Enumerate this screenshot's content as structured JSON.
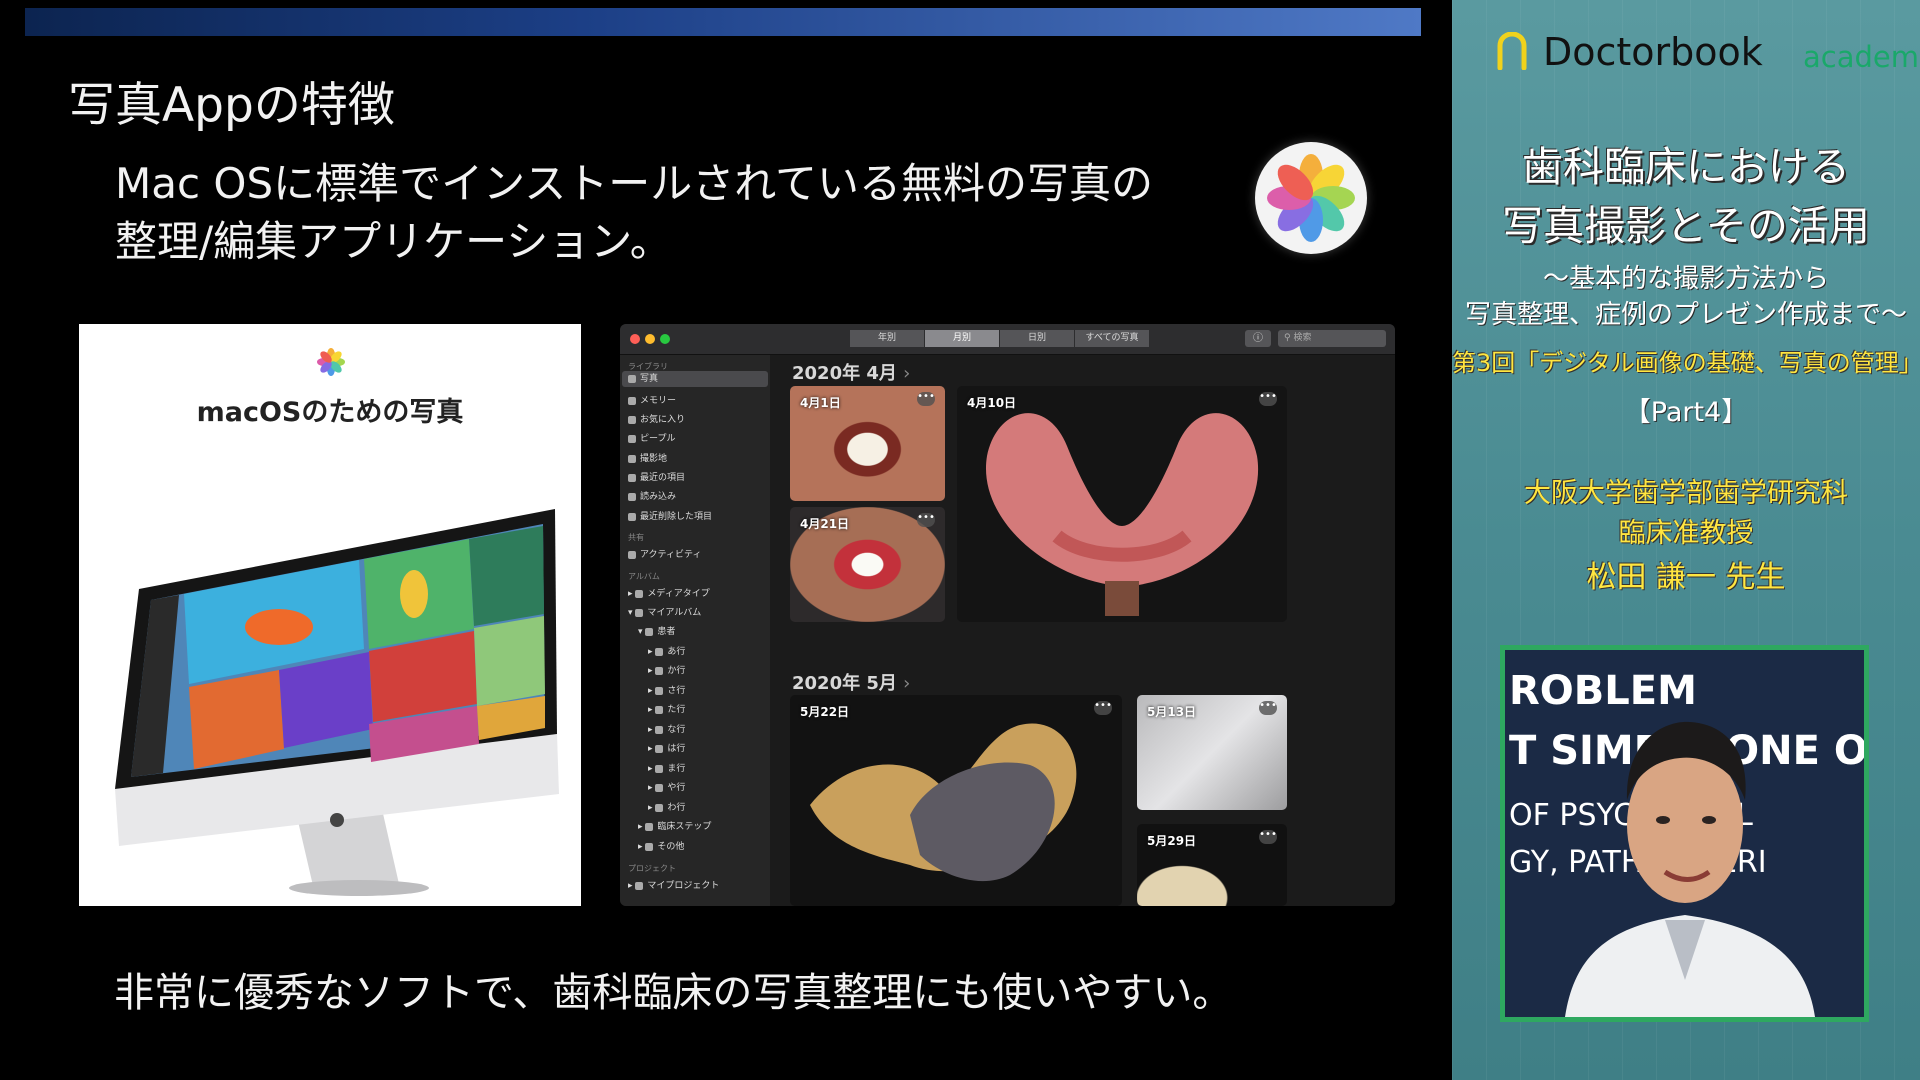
{
  "slide": {
    "title": "写真Appの特徴",
    "intro_line1": "Mac OSに標準でインストールされている無料の写真の",
    "intro_line2": "整理/編集アプリケーション。",
    "caption": "非常に優秀なソフトで、歯科臨床の写真整理にも使いやすい。",
    "product_title": "macOSのための写真"
  },
  "photos_app": {
    "view_tabs": [
      {
        "label": "年別",
        "active": false
      },
      {
        "label": "月別",
        "active": true
      },
      {
        "label": "日別",
        "active": false
      },
      {
        "label": "すべての写真",
        "active": false
      }
    ],
    "search_placeholder": "検索",
    "sidebar": {
      "library_header": "ライブラリ",
      "library_items": [
        "写真",
        "メモリー",
        "お気に入り",
        "ピープル",
        "撮影地",
        "最近の項目",
        "読み込み",
        "最近削除した項目"
      ],
      "shared_header": "共有",
      "shared_items": [
        "アクティビティ"
      ],
      "albums_header": "アルバム",
      "album_items": [
        "メディアタイプ",
        "マイアルバム",
        "患者"
      ],
      "patient_folders": [
        "あ行",
        "か行",
        "さ行",
        "た行",
        "な行",
        "は行",
        "ま行",
        "や行",
        "わ行"
      ],
      "other_albums": [
        "臨床ステップ",
        "その他"
      ],
      "projects_header": "プロジェクト",
      "project_items": [
        "マイプロジェクト"
      ]
    },
    "months": [
      {
        "label": "2020年 4月",
        "dates": [
          "4月1日",
          "4月21日",
          "4月10日"
        ]
      },
      {
        "label": "2020年 5月",
        "dates": [
          "5月22日",
          "5月13日",
          "5月29日"
        ]
      }
    ]
  },
  "sidebar_panel": {
    "brand": "Doctorbook",
    "brand_sub": "academy",
    "course_title_1": "歯科臨床における",
    "course_title_2": "写真撮影とその活用",
    "subtitle_1": "〜基本的な撮影方法から",
    "subtitle_2": "写真整理、症例のプレゼン作成まで〜",
    "session": "第3回「デジタル画像の基礎、写真の管理」",
    "part": "【Part4】",
    "affiliation": "大阪大学歯学部歯学研究科",
    "position": "臨床准教授",
    "lecturer": "松田 謙一 先生"
  },
  "webcam": {
    "background_lines": [
      "ROBLEM",
      "T SIMPLY ONE OF M",
      "OF PSYCH   YSIOL",
      "GY, PATHO   NEERI"
    ]
  }
}
